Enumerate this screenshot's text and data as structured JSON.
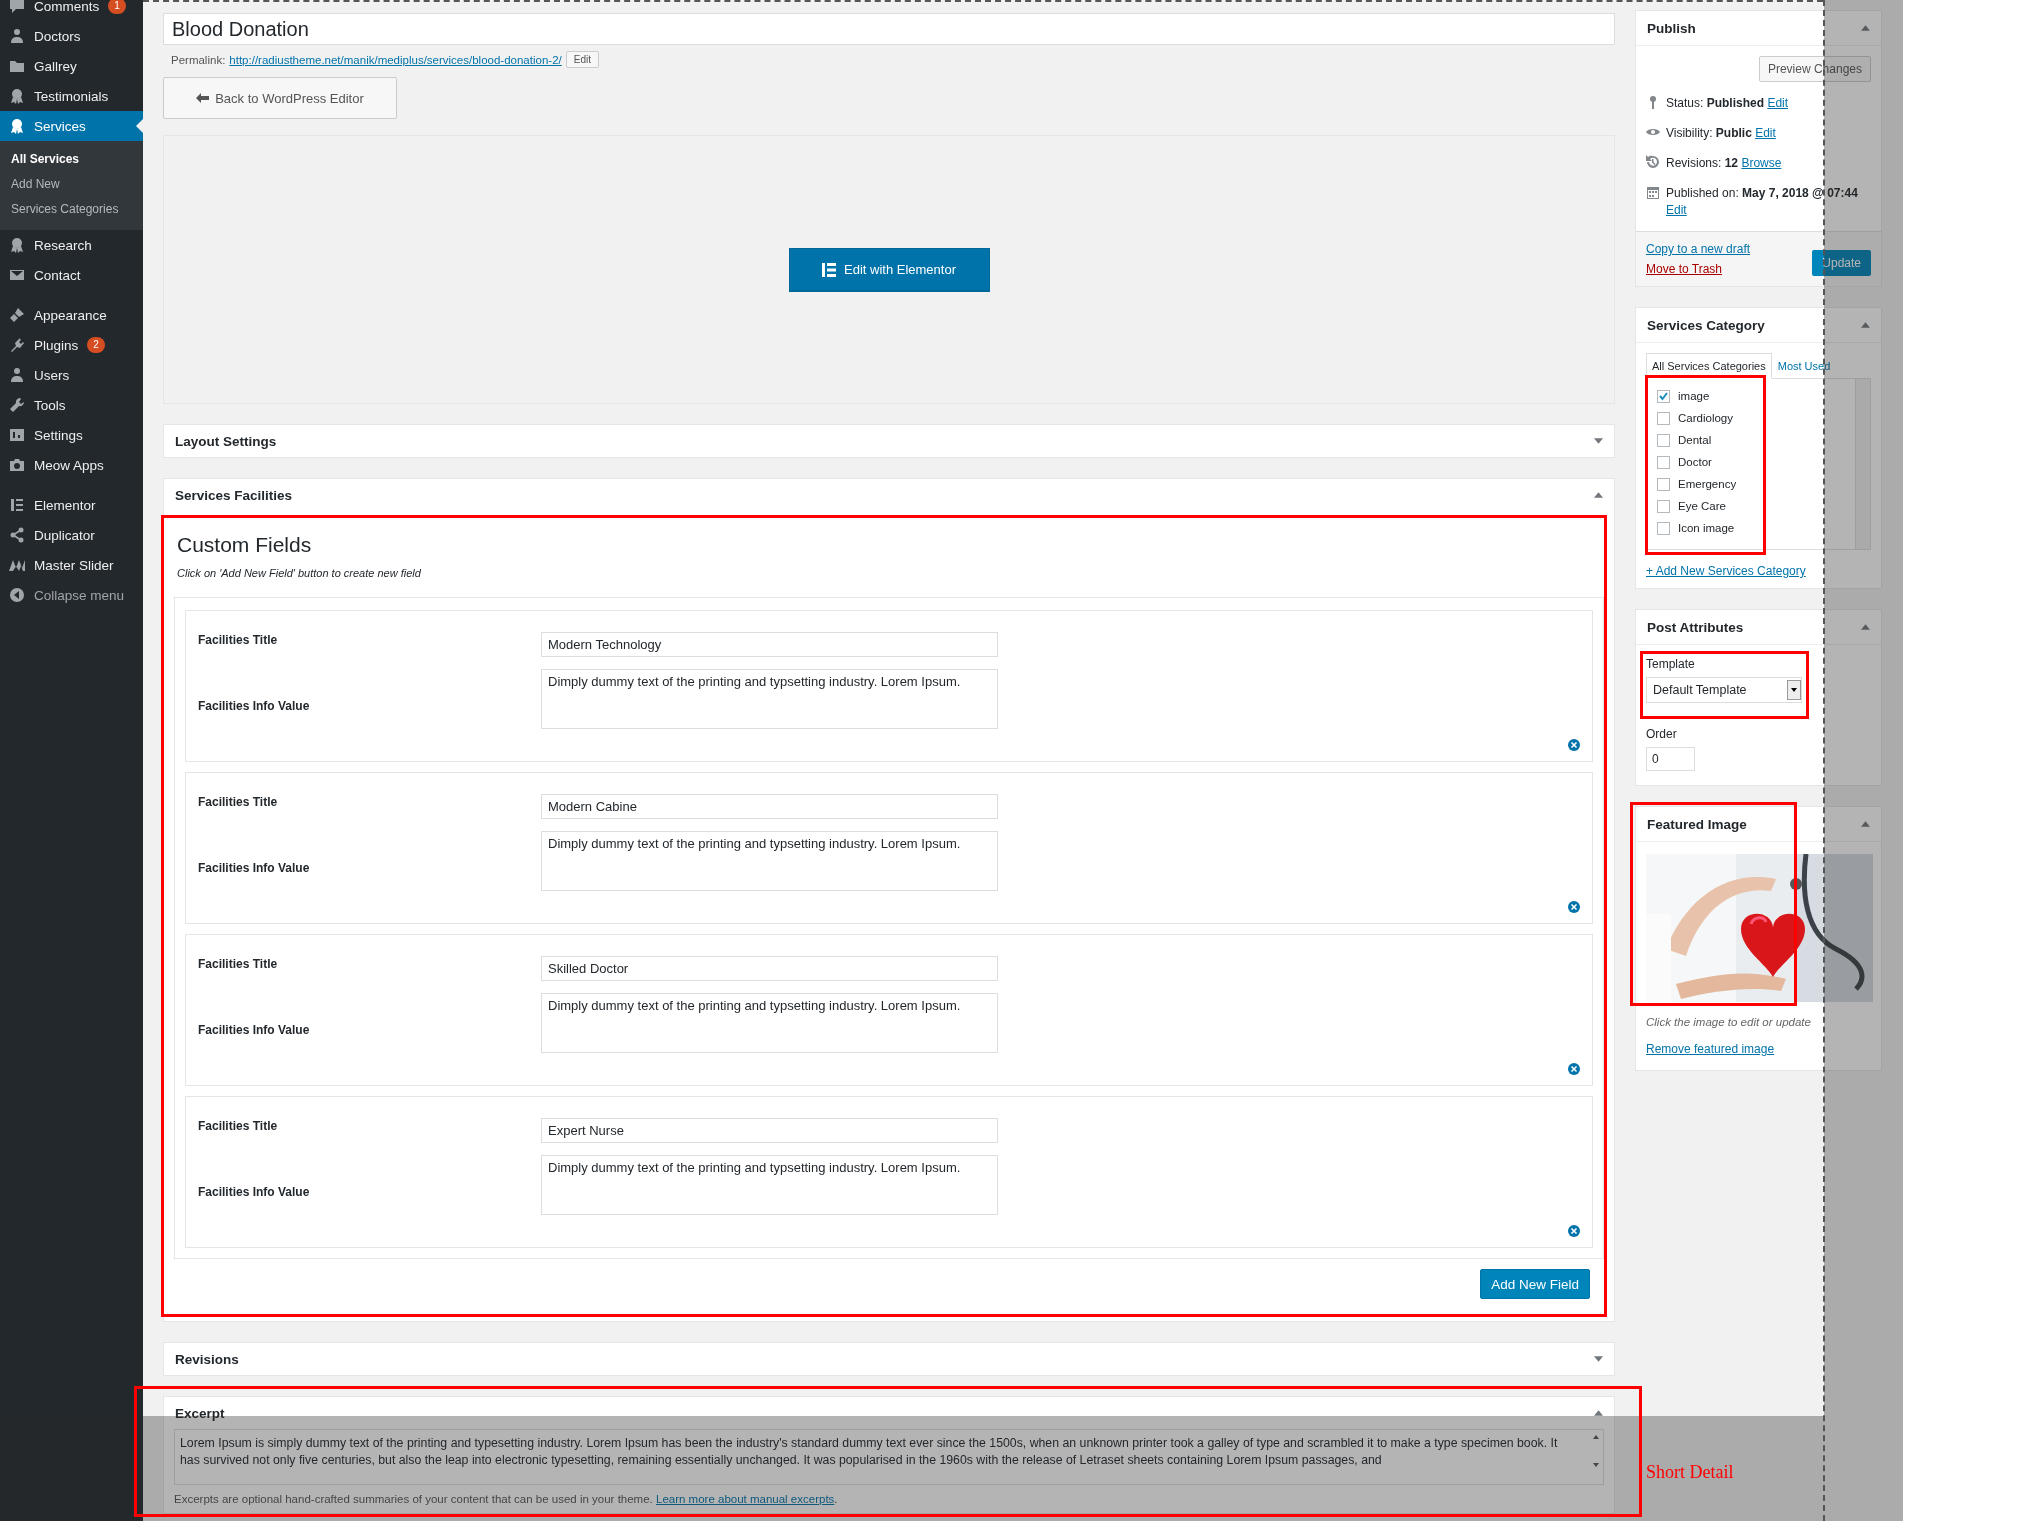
{
  "sidebar": {
    "groups": [
      {
        "items": [
          {
            "label": "Comments",
            "selected": false,
            "badge": "1"
          },
          {
            "label": "Doctors",
            "selected": false
          },
          {
            "label": "Gallrey",
            "selected": false
          },
          {
            "label": "Testimonials",
            "selected": false
          },
          {
            "label": "Services",
            "selected": true,
            "children": [
              {
                "label": "All Services",
                "selected": true
              },
              {
                "label": "Add New",
                "selected": false
              },
              {
                "label": "Services Categories",
                "selected": false
              }
            ]
          },
          {
            "label": "Research",
            "selected": false
          },
          {
            "label": "Contact",
            "selected": false
          }
        ]
      },
      {
        "items": [
          {
            "label": "Appearance",
            "selected": false
          },
          {
            "label": "Plugins",
            "selected": false,
            "badge": "2"
          },
          {
            "label": "Users",
            "selected": false
          },
          {
            "label": "Tools",
            "selected": false
          },
          {
            "label": "Settings",
            "selected": false
          },
          {
            "label": "Meow Apps",
            "selected": false
          }
        ]
      },
      {
        "items": [
          {
            "label": "Elementor",
            "selected": false
          },
          {
            "label": "Duplicator",
            "selected": false
          },
          {
            "label": "Master Slider",
            "selected": false
          },
          {
            "label": "Collapse menu",
            "selected": false
          }
        ]
      }
    ]
  },
  "title_field": {
    "value": "Blood Donation"
  },
  "permalink": {
    "label": "Permalink:",
    "url": "http://radiustheme.net/manik/mediplus/services/blood-donation-2/",
    "button": "Edit"
  },
  "back_button": "Back to WordPress Editor",
  "elementor_button": "Edit with Elementor",
  "layout_panel": {
    "title": "Layout Settings",
    "expanded": false
  },
  "facilities_panel": {
    "title": "Services Facilities",
    "expanded": true,
    "custom_fields": {
      "title": "Custom Fields",
      "hint": "Click on 'Add New Field' button to create new field",
      "rows": [
        {
          "title_label": "Facilities Title",
          "title_value": "Modern Technology",
          "info_label": "Facilities Info Value",
          "info_value": "Dimply dummy text of the printing and typsetting industry. Lorem Ipsum."
        },
        {
          "title_label": "Facilities Title",
          "title_value": "Modern Cabine",
          "info_label": "Facilities Info Value",
          "info_value": "Dimply dummy text of the printing and typsetting industry. Lorem Ipsum."
        },
        {
          "title_label": "Facilities Title",
          "title_value": "Skilled Doctor",
          "info_label": "Facilities Info Value",
          "info_value": "Dimply dummy text of the printing and typsetting industry. Lorem Ipsum."
        },
        {
          "title_label": "Facilities Title",
          "title_value": "Expert Nurse",
          "info_label": "Facilities Info Value",
          "info_value": "Dimply dummy text of the printing and typsetting industry. Lorem Ipsum."
        }
      ],
      "add_button": "Add New Field"
    }
  },
  "revisions_panel": {
    "title": "Revisions",
    "expanded": false
  },
  "excerpt_panel": {
    "title": "Excerpt",
    "expanded": true,
    "value": "Lorem Ipsum is simply dummy text of the printing and typesetting industry. Lorem Ipsum has been the industry's standard dummy text ever since the 1500s, when an unknown printer took a galley of type and scrambled it to make a type specimen book. It has survived not only five centuries, but also the leap into electronic typesetting, remaining essentially unchanged. It was popularised in the 1960s with the release of Letraset sheets containing Lorem Ipsum passages, and",
    "help": "Excerpts are optional hand-crafted summaries of your content that can be used in your theme.",
    "help_link": "Learn more about manual excerpts",
    "help_end": "."
  },
  "publish_panel": {
    "title": "Publish",
    "expanded": true,
    "preview_button": "Preview Changes",
    "meta": [
      {
        "kind": "status",
        "label": "Status:",
        "value": "Published",
        "link": "Edit"
      },
      {
        "kind": "visibility",
        "label": "Visibility:",
        "value": "Public",
        "link": "Edit"
      },
      {
        "kind": "revisions",
        "label": "Revisions:",
        "value": "12",
        "link": "Browse"
      },
      {
        "kind": "date",
        "label": "Published on:",
        "value": "May 7, 2018 @ 07:44",
        "link": "Edit"
      }
    ],
    "copy_link": "Copy to a new draft",
    "trash_link": "Move to Trash",
    "update_button": "Update"
  },
  "category_panel": {
    "title": "Services Category",
    "expanded": true,
    "tabs": [
      {
        "label": "All Services Categories",
        "selected": true
      },
      {
        "label": "Most Used",
        "selected": false
      }
    ],
    "categories": [
      {
        "label": "image",
        "checked": true
      },
      {
        "label": "Cardiology",
        "checked": false
      },
      {
        "label": "Dental",
        "checked": false
      },
      {
        "label": "Doctor",
        "checked": false
      },
      {
        "label": "Emergency",
        "checked": false
      },
      {
        "label": "Eye Care",
        "checked": false
      },
      {
        "label": "Icon image",
        "checked": false
      }
    ],
    "add_link": "+ Add New Services Category"
  },
  "attributes_panel": {
    "title": "Post Attributes",
    "expanded": true,
    "template_label": "Template",
    "template_value": "Default Template",
    "order_label": "Order",
    "order_value": "0"
  },
  "featured_panel": {
    "title": "Featured Image",
    "expanded": true,
    "hint": "Click the image to edit or update",
    "remove_link": "Remove featured image"
  },
  "annotation": "Short Detail"
}
